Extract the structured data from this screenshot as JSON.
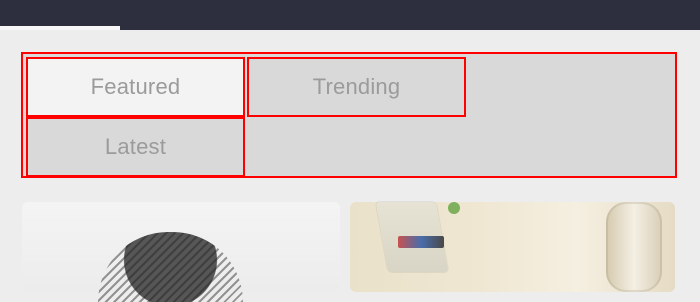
{
  "tabs": {
    "items": [
      {
        "label": "Featured",
        "selected": true
      },
      {
        "label": "Trending",
        "selected": false
      },
      {
        "label": "Latest",
        "selected": false
      }
    ]
  },
  "colors": {
    "topbar": "#2d2f3f",
    "tabs_background": "#d9d9d9",
    "tab_selected_background": "#f3f3f3",
    "tab_text": "#9b9b9b",
    "outline_red": "#ff0000"
  },
  "icons": {
    "topbar_indicator": "tab-underline-indicator"
  }
}
